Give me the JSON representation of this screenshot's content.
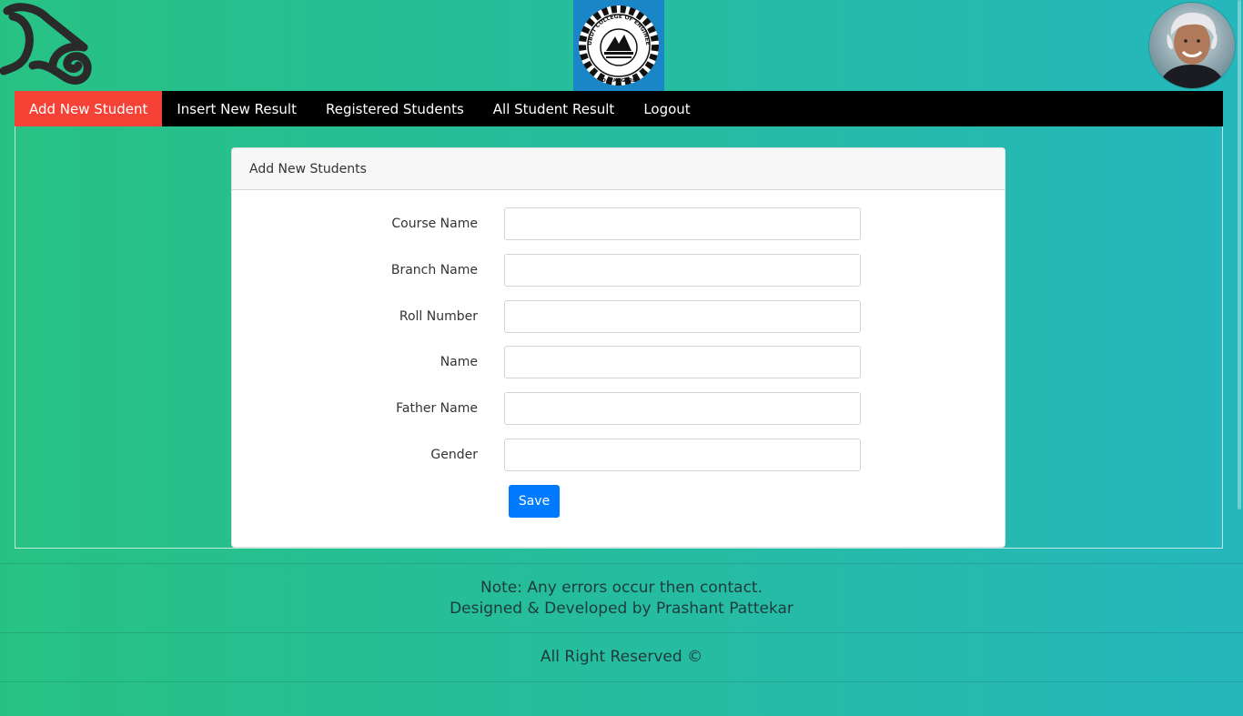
{
  "header": {
    "left_logo_icon": "scroll-swirl-logo-icon",
    "college_logo": {
      "icon": "college-seal-logo-icon",
      "ring_text": "UBDT COLLEGE OF ENGINEERING",
      "bottom_text": "DAVANGERE"
    },
    "avatar_icon": "user-avatar-portrait"
  },
  "nav": {
    "items": [
      {
        "label": "Add New Student",
        "active": true
      },
      {
        "label": "Insert New Result",
        "active": false
      },
      {
        "label": "Registered Students",
        "active": false
      },
      {
        "label": "All Student Result",
        "active": false
      },
      {
        "label": "Logout",
        "active": false
      }
    ]
  },
  "form": {
    "title": "Add New Students",
    "fields": [
      {
        "label": "Course Name",
        "value": ""
      },
      {
        "label": "Branch Name",
        "value": ""
      },
      {
        "label": "Roll Number",
        "value": ""
      },
      {
        "label": "Name",
        "value": ""
      },
      {
        "label": "Father Name",
        "value": ""
      },
      {
        "label": "Gender",
        "value": ""
      }
    ],
    "save_label": "Save"
  },
  "footer": {
    "note": "Note: Any errors occur then contact.",
    "credit": "Designed & Developed by Prashant Pattekar",
    "rights": "All Right Reserved ©"
  },
  "colors": {
    "nav_active": "#f44336",
    "nav_bg": "#000000",
    "primary_button": "#007bff",
    "gradient_left": "#27c283",
    "gradient_right": "#25b7bc"
  }
}
